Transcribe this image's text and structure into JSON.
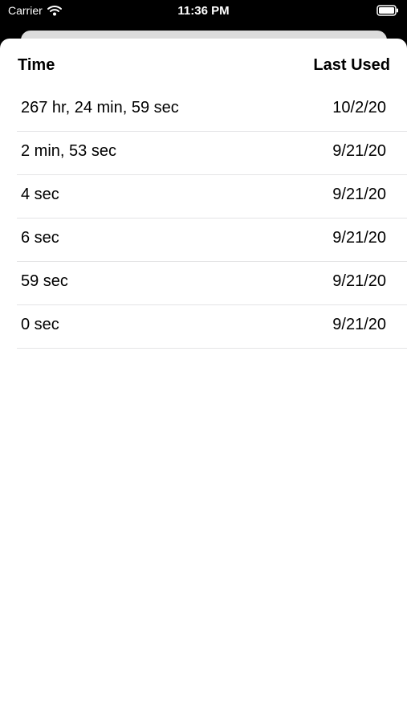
{
  "status_bar": {
    "carrier": "Carrier",
    "time": "11:36 PM"
  },
  "icons": {
    "wifi": "wifi-icon",
    "battery": "battery-icon"
  },
  "table": {
    "headers": {
      "time": "Time",
      "last_used": "Last Used"
    },
    "rows": [
      {
        "duration": "267 hr, 24 min, 59 sec",
        "date": "10/2/20"
      },
      {
        "duration": "2 min, 53 sec",
        "date": "9/21/20"
      },
      {
        "duration": "4 sec",
        "date": "9/21/20"
      },
      {
        "duration": "6 sec",
        "date": "9/21/20"
      },
      {
        "duration": "59 sec",
        "date": "9/21/20"
      },
      {
        "duration": "0 sec",
        "date": "9/21/20"
      }
    ]
  },
  "colors": {
    "background": "#000000",
    "sheet": "#ffffff",
    "separator": "#e4e4e6",
    "back_card": "#dcdcdc"
  }
}
